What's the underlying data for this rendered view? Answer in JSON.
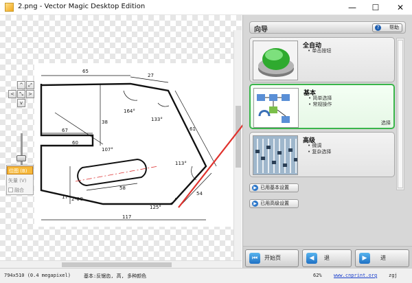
{
  "window": {
    "title": "2.png - Vector Magic Desktop Edition",
    "minimize": "—",
    "maximize": "☐",
    "close": "✕"
  },
  "drawing": {
    "dims": [
      "65",
      "27",
      "164°",
      "133°",
      "61",
      "67",
      "38",
      "60",
      "107°",
      "113°",
      "54",
      "17",
      "2-Φ8",
      "125°",
      "58",
      "117"
    ]
  },
  "view_controls": {
    "nav": [
      "^",
      "<",
      "⤡",
      ">",
      "v",
      "⤢"
    ],
    "original_label": "位图 (B)",
    "result_label": "矢量 (V)",
    "mix_label": "融合"
  },
  "panel": {
    "header_title": "向导",
    "help_label": "帮助",
    "modes": [
      {
        "name": "全自动",
        "bullets": [
          "单击按钮"
        ],
        "thumb": "green-push-button"
      },
      {
        "name": "基本",
        "bullets": [
          "简单选择",
          "常规操作"
        ],
        "thumb": "flow-diagram",
        "selected_label": "选择"
      },
      {
        "name": "高级",
        "bullets": [
          "微调",
          "复杂选择"
        ],
        "thumb": "mixing-console"
      }
    ],
    "basic_settings_label": "已用基本设置",
    "advanced_settings_label": "已用高级设置",
    "start_label": "开始页",
    "back_label": "退",
    "next_label": "进"
  },
  "status": {
    "image_info": "794x510 (0.4 megapixel)",
    "settings_info": "基本:反锯齿, 高, 多种颜色",
    "zoom": "62%",
    "website": "www.cnprint.org",
    "user": "zgj"
  },
  "colors": {
    "selected_border": "#39b54a",
    "accent_blue": "#1f71c4",
    "annotation_arrow": "#e0322d",
    "original_button": "#f7b93a"
  }
}
